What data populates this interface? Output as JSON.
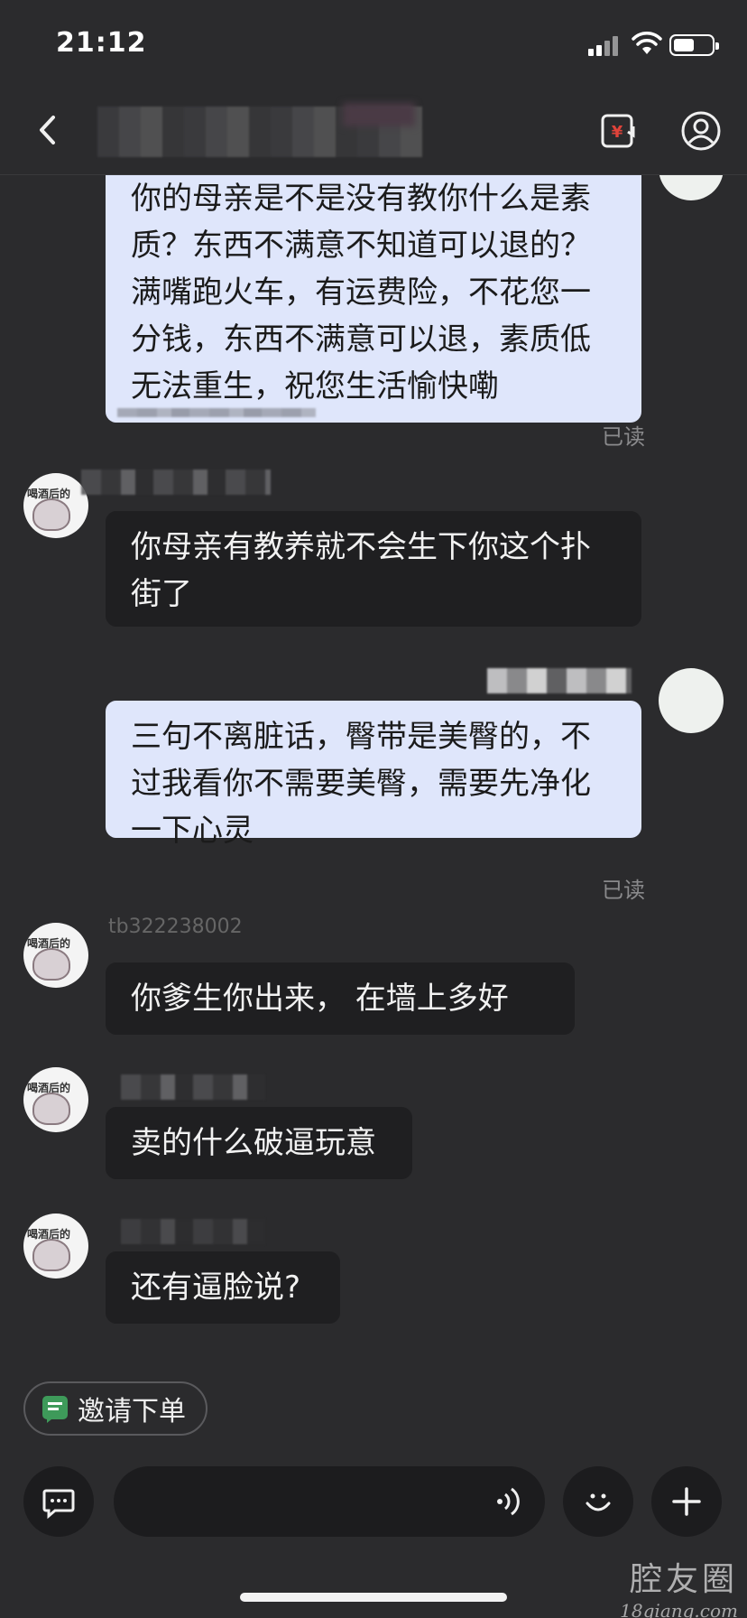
{
  "status_bar": {
    "time": "21:12"
  },
  "header": {
    "price_icon": "yuan-refresh-icon",
    "profile_icon": "user-circle-icon"
  },
  "messages": [
    {
      "direction": "out",
      "text": "你的母亲是不是没有教你什么是素质？东西不满意不知道可以退的？满嘴跑火车，有运费险，不花您一分钱，东西不满意可以退，素质低无法重生，祝您生活愉快嘞",
      "status": "已读"
    },
    {
      "direction": "in",
      "text": "你母亲有教养就不会生下你这个扑街了"
    },
    {
      "direction": "out",
      "text": "三句不离脏话，臀带是美臀的，不过我看你不需要美臀，需要先净化一下心灵",
      "status": "已读"
    },
    {
      "direction": "in",
      "sender_partial": "tb322238002",
      "text": "你爹生你出来， 在墙上多好"
    },
    {
      "direction": "in",
      "text": "卖的什么破逼玩意"
    },
    {
      "direction": "in",
      "text": "还有逼脸说?"
    }
  ],
  "avatar_label": "喝酒后的",
  "invite_chip": {
    "label": "邀请下单"
  },
  "input": {
    "placeholder": ""
  },
  "watermark": {
    "main": "腔友圈",
    "sub": "18qiang.com"
  }
}
